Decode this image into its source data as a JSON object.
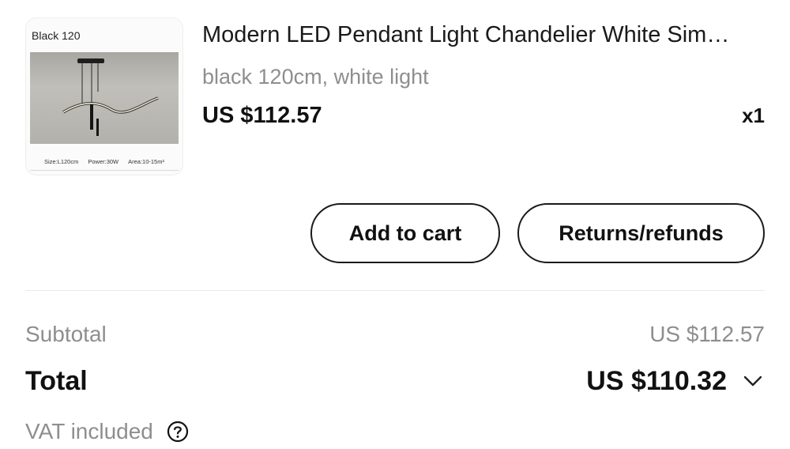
{
  "product": {
    "image_label": "Black 120",
    "image_specs": [
      "Size:L120cm",
      "Power:30W",
      "Area:10-15m²"
    ],
    "title": "Modern LED Pendant Light Chandelier White Sim…",
    "variant": "black 120cm, white light",
    "price": "US $112.57",
    "quantity": "x1"
  },
  "actions": {
    "add_to_cart": "Add to cart",
    "returns": "Returns/refunds"
  },
  "summary": {
    "subtotal_label": "Subtotal",
    "subtotal_value": "US $112.57",
    "total_label": "Total",
    "total_value": "US $110.32",
    "vat_label": "VAT included"
  },
  "icons": {
    "expand": "chevron-down-icon",
    "help": "question-circle-icon"
  }
}
